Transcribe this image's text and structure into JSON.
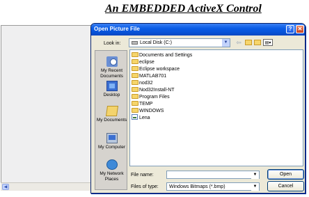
{
  "page": {
    "title": "An EMBEDDED ActiveX Control"
  },
  "dialog": {
    "title": "Open Picture File",
    "help_glyph": "?",
    "close_glyph": "✕",
    "look_in_label": "Look in:",
    "look_in_value": "Local Disk (C:)",
    "places": [
      {
        "label": "My Recent Documents",
        "icon": "recent-documents-icon"
      },
      {
        "label": "Desktop",
        "icon": "desktop-icon"
      },
      {
        "label": "My Documents",
        "icon": "my-documents-icon"
      },
      {
        "label": "My Computer",
        "icon": "my-computer-icon"
      },
      {
        "label": "My Network Places",
        "icon": "network-places-icon"
      }
    ],
    "files": [
      "Documents and Settings",
      "eclipse",
      "Eclipse workspace",
      "MATLAB701",
      "nod32",
      "Nod32Install-NT",
      "Program Files",
      "TEMP",
      "WINDOWS",
      "Lena"
    ],
    "file_name_label": "File name:",
    "file_name_value": "",
    "file_type_label": "Files of type:",
    "file_type_value": "Windows Bitmaps (*.bmp)",
    "open_label": "Open",
    "cancel_label": "Cancel"
  }
}
